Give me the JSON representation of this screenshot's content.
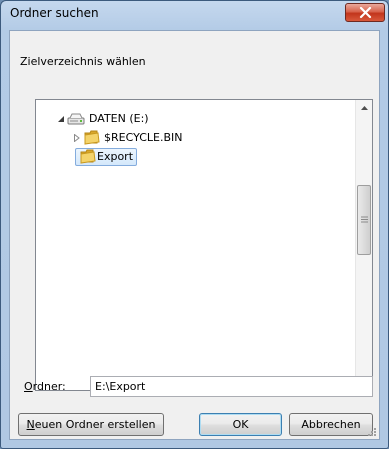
{
  "window": {
    "title": "Ordner suchen",
    "close_icon": "close-icon"
  },
  "description": "Zielverzeichnis wählen",
  "tree": {
    "nodes": [
      {
        "label": "DATEN (E:)",
        "icon": "drive-icon",
        "expander": "expanded"
      },
      {
        "label": "$RECYCLE.BIN",
        "icon": "folder-icon",
        "expander": "collapsed"
      },
      {
        "label": "Export",
        "icon": "folder-icon",
        "expander": "none",
        "selected": true
      }
    ]
  },
  "folder_field": {
    "label_prefix": "",
    "label_access_key": "O",
    "label_rest": "rdner:",
    "value": "E:\\Export"
  },
  "buttons": {
    "new_folder_access_key": "N",
    "new_folder_rest": "euen Ordner erstellen",
    "ok": "OK",
    "cancel": "Abbrechen"
  },
  "colors": {
    "selection_border": "#84acdd",
    "close_button": "#c2351c",
    "folder_yellow": "#e9c35a"
  }
}
